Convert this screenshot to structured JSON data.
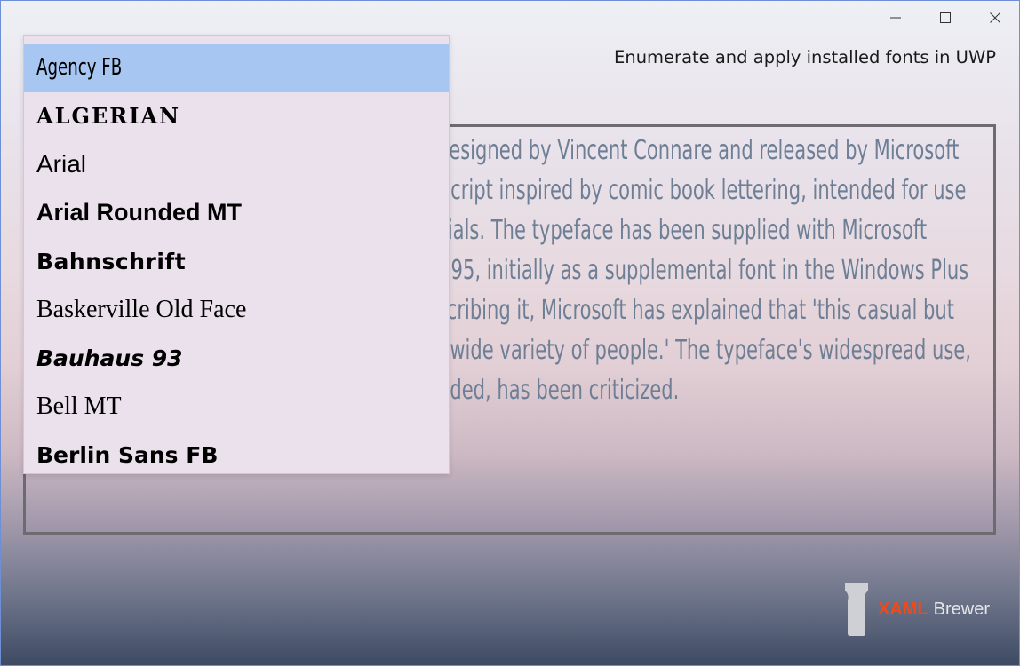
{
  "window": {
    "controls": {
      "minimize": "minimize-icon",
      "maximize": "maximize-icon",
      "close": "close-icon"
    }
  },
  "app": {
    "title": "Enumerate and apply installed fonts in UWP"
  },
  "sample": {
    "text": "Comic Sans MS is a casual script typeface designed by Vincent Connare and released by Microsoft Corporation. It is a casual, non-connecting script inspired by comic book lettering, intended for use in informal documents and children's materials. The typeface has been supplied with Microsoft Windows since the introduction of Windows 95, initially as a supplemental font in the Windows Plus Pack and later in Microsoft Comic Chat. Describing it, Microsoft has explained that 'this casual but legible face has proved very popular with a wide variety of people.' The typeface's widespread use, often in situations for which it was not intended, has been criticized."
  },
  "fontList": {
    "selected": "Agency FB",
    "items": [
      "Agency FB",
      "ALGERIAN",
      "Arial",
      "Arial Rounded MT",
      "Bahnschrift",
      "Baskerville Old Face",
      "Bauhaus 93",
      "Bell MT",
      "Berlin Sans FB"
    ]
  },
  "brand": {
    "xaml": "XAML",
    "brewer": "Brewer"
  },
  "colors": {
    "selection": "#a7c6f2",
    "dropdown_bg": "#ebe1ed",
    "sample_text": "#6e7f95",
    "brand_accent": "#ef4a17",
    "frame_border": "#6d6a70"
  }
}
